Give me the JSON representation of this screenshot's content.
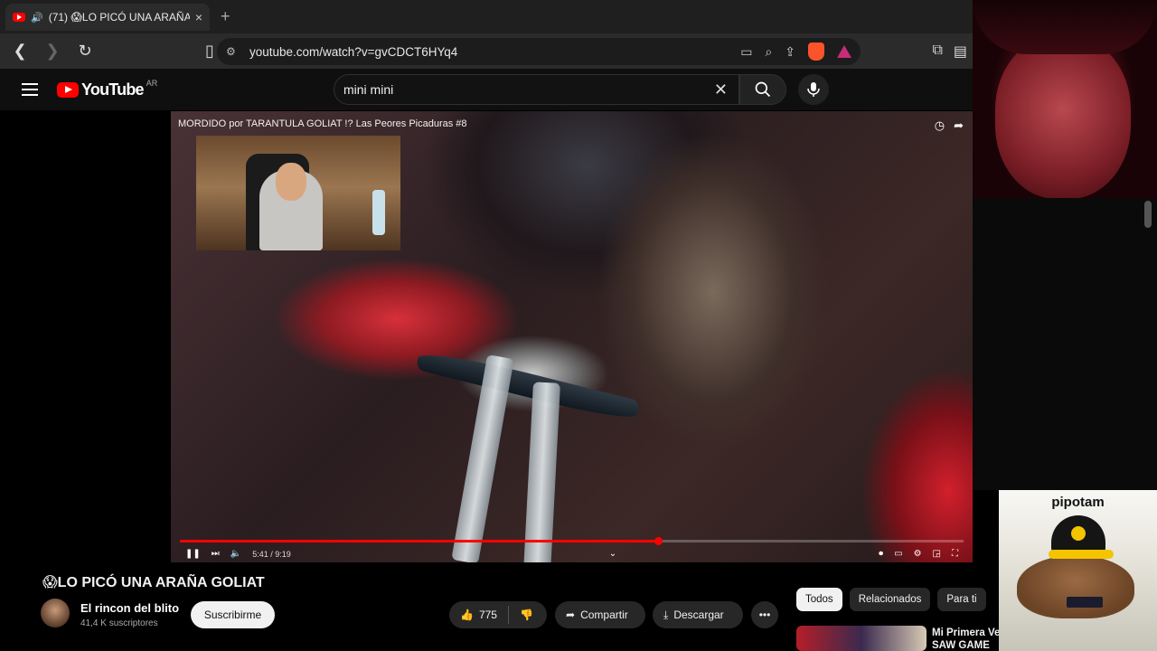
{
  "browser": {
    "tab": {
      "count_prefix": "(71)",
      "title": "😱LO PICÓ UNA ARAÑA GOLIAT",
      "close": "×"
    },
    "new_tab": "+",
    "url": "youtube.com/watch?v=gvCDCT6HYq4"
  },
  "youtube": {
    "logo_word": "YouTube",
    "region": "AR",
    "search_value": "mini mini"
  },
  "video": {
    "overlay_title": "MORDIDO por TARANTULA GOLIAT !? Las Peores Picaduras #8",
    "time": "5:41 / 9:19",
    "progress_fraction": 0.61,
    "buffered_fraction": 0.63
  },
  "watch": {
    "title": "😱LO PICÓ UNA ARAÑA GOLIAT",
    "channel_name": "El rincon del blito",
    "subscribers": "41,4 K suscriptores",
    "subscribe_label": "Suscribirme",
    "likes": "775",
    "share_label": "Compartir",
    "download_label": "Descargar",
    "more": "•••"
  },
  "sidebar": {
    "chips": [
      "Todos",
      "Relacionados",
      "Para ti"
    ],
    "rec_title_line1": "Mi Primera Ve",
    "rec_title_line2": "SAW GAME"
  },
  "overlay": {
    "pipotam_name": "pipotam"
  },
  "colors": {
    "yt_red": "#ff0000",
    "background": "#0f0f0f",
    "pill": "#272727"
  }
}
